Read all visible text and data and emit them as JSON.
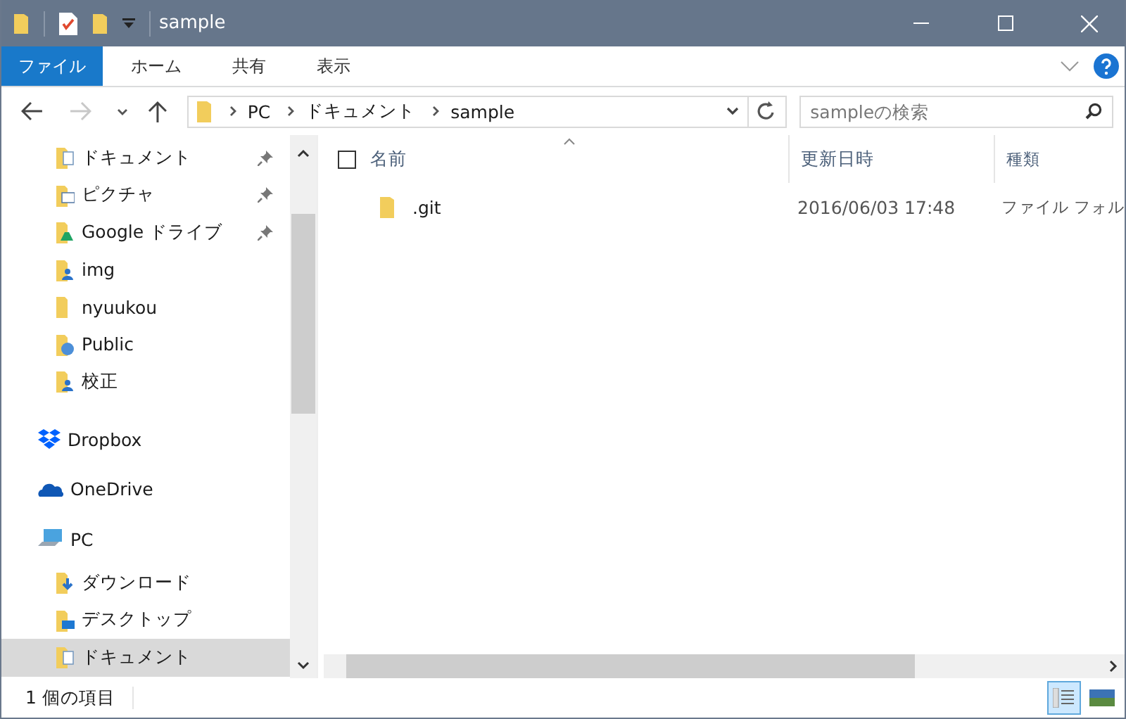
{
  "window": {
    "title": "sample"
  },
  "ribbon": {
    "tabs": [
      {
        "label": "ファイル",
        "selected": true
      },
      {
        "label": "ホーム",
        "selected": false
      },
      {
        "label": "共有",
        "selected": false
      },
      {
        "label": "表示",
        "selected": false
      }
    ]
  },
  "address_bar": {
    "path": [
      "PC",
      "ドキュメント",
      "sample"
    ]
  },
  "search": {
    "placeholder": "sampleの検索"
  },
  "nav": {
    "quick_access": [
      {
        "label": "ドキュメント",
        "kind": "documents",
        "pinned": true,
        "selected": false
      },
      {
        "label": "ピクチャ",
        "kind": "pictures",
        "pinned": true,
        "selected": false
      },
      {
        "label": "Google ドライブ",
        "kind": "gdrive",
        "pinned": true,
        "selected": false
      },
      {
        "label": "img",
        "kind": "user",
        "pinned": false,
        "selected": false
      },
      {
        "label": "nyuukou",
        "kind": "folder",
        "pinned": false,
        "selected": false
      },
      {
        "label": "Public",
        "kind": "public",
        "pinned": false,
        "selected": false
      },
      {
        "label": "校正",
        "kind": "user",
        "pinned": false,
        "selected": false
      }
    ],
    "roots": [
      {
        "label": "Dropbox",
        "kind": "dropbox",
        "selected": false
      },
      {
        "label": "OneDrive",
        "kind": "onedrive",
        "selected": false
      },
      {
        "label": "PC",
        "kind": "pc",
        "selected": false,
        "children": [
          {
            "label": "ダウンロード",
            "kind": "downloads",
            "selected": false
          },
          {
            "label": "デスクトップ",
            "kind": "desktop",
            "selected": false
          },
          {
            "label": "ドキュメント",
            "kind": "documents",
            "selected": true
          }
        ]
      }
    ]
  },
  "table": {
    "select_all_checked": false,
    "columns": [
      "名前",
      "更新日時",
      "種類"
    ],
    "rows": [
      {
        "name": ".git",
        "modified": "2016/06/03 17:48",
        "type": "ファイル フォル"
      }
    ]
  },
  "status_bar": {
    "count": "1 個の項目"
  },
  "view_buttons": [
    {
      "kind": "details",
      "selected": true
    },
    {
      "kind": "tiles",
      "selected": false
    }
  ]
}
